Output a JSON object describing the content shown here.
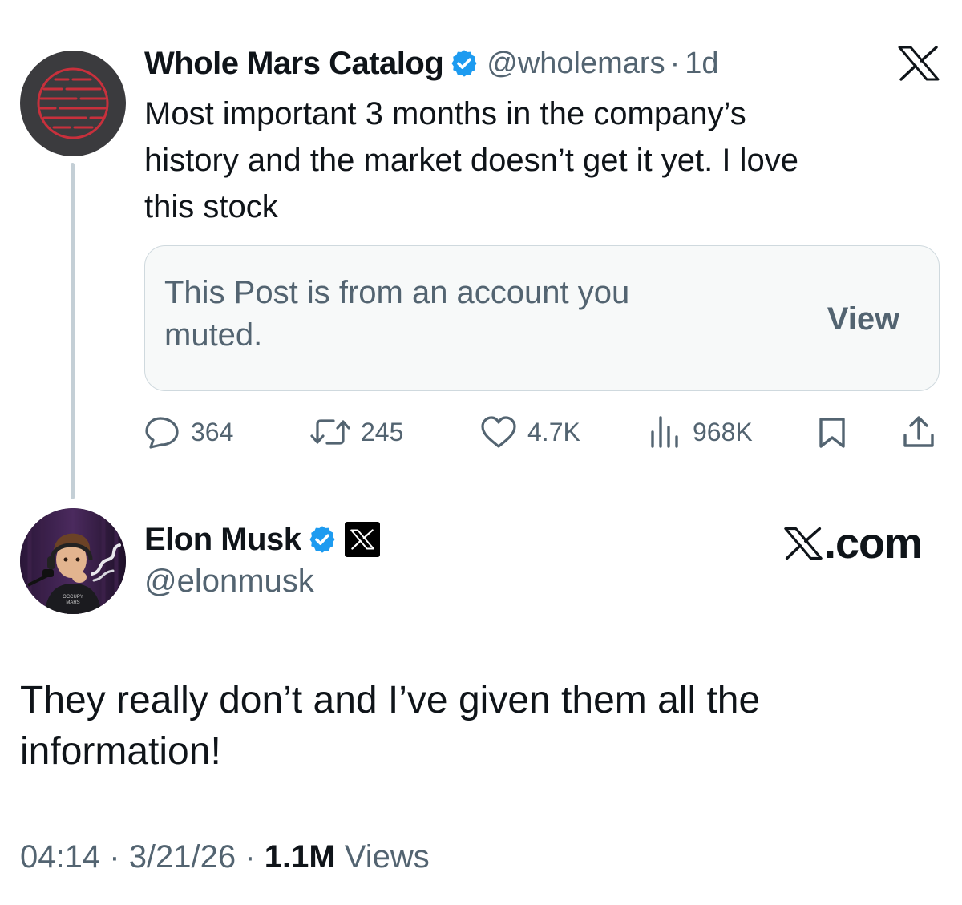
{
  "parent_post": {
    "author_name": "Whole Mars Catalog",
    "handle": "@wholemars",
    "separator": "·",
    "time_ago": "1d",
    "text_lines": [
      "Most important 3 months in the company’s",
      "history and the market doesn’t get it yet. I love",
      "this stock"
    ],
    "muted_card": {
      "lines": [
        "This Post is from an account you",
        "muted."
      ],
      "view_label": "View"
    },
    "actions": {
      "replies": "364",
      "reposts": "245",
      "likes": "4.7K",
      "views": "968K"
    },
    "icons": {
      "verified": "verified-badge-icon",
      "platform": "x-logo-icon",
      "reply": "reply-icon",
      "repost": "repost-icon",
      "like": "heart-icon",
      "views": "analytics-icon",
      "bookmark": "bookmark-icon",
      "share": "share-icon"
    }
  },
  "reply_post": {
    "author_name": "Elon Musk",
    "handle": "@elonmusk",
    "brand_text": ".com",
    "text_lines": [
      "They really don’t and I’ve given them all the",
      "information!"
    ],
    "avatar_caption": [
      "OCCUPY",
      "MARS"
    ],
    "meta": {
      "time": "04:14",
      "date": "3/21/26",
      "views_count": "1.1M",
      "views_label": "Views",
      "separator": "·"
    }
  },
  "colors": {
    "text_primary": "#0f1419",
    "text_secondary": "#536471",
    "verified_blue": "#1d9bf0",
    "card_bg": "#f7f9f9",
    "card_border": "#cfd9de",
    "thread_line": "#c4cfd6"
  }
}
